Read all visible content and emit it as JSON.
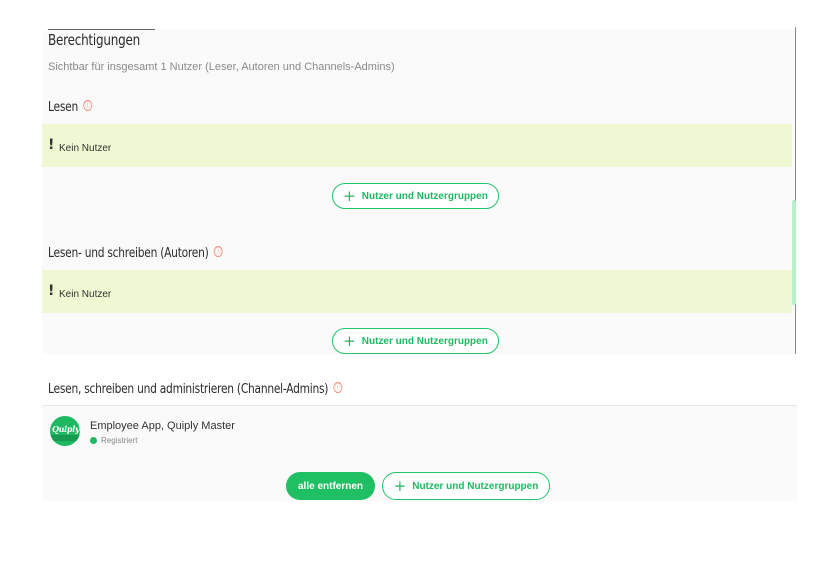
{
  "permissions": {
    "title": "Berechtigungen",
    "subtitle": "Sichtbar für insgesamt 1 Nutzer (Leser, Autoren und Channels-Admins)"
  },
  "sections": {
    "read": {
      "title": "Lesen",
      "info_icon": "ⓘ",
      "warning": "Kein Nutzer",
      "add_label": "Nutzer und Nutzergruppen"
    },
    "write": {
      "title": "Lesen- und schreiben (Autoren)",
      "info_icon": "ⓘ",
      "warning": "Kein Nutzer",
      "add_label": "Nutzer und Nutzergruppen"
    },
    "admin": {
      "title": "Lesen, schreiben und administrieren (Channel-Admins)",
      "info_icon": "ⓘ",
      "add_label": "Nutzer und Nutzergruppen",
      "remove_all_label": "alle entfernen",
      "users": [
        {
          "name": "Employee App, Quiply Master",
          "status": "Registriert",
          "avatar_text": "Quiply"
        }
      ]
    }
  },
  "icons": {
    "warning": "!",
    "plus": "+"
  },
  "colors": {
    "accent": "#1fb862",
    "warning_bg": "#eff8d2",
    "info": "#f0917a"
  }
}
